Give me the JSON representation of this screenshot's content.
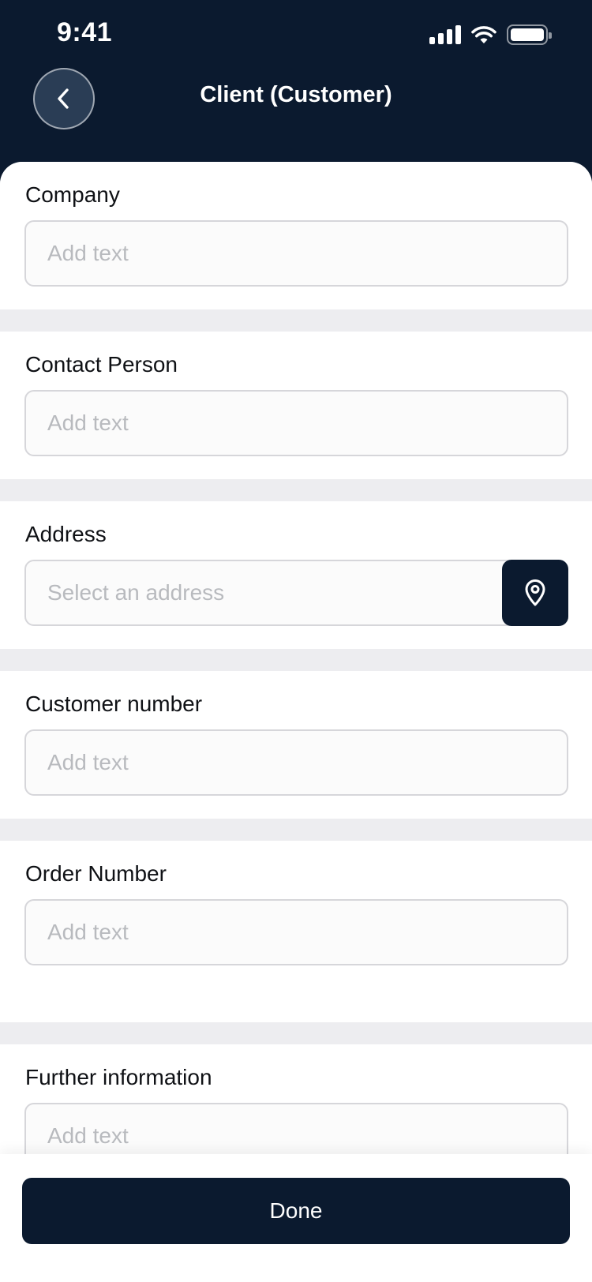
{
  "status_bar": {
    "time": "9:41"
  },
  "header": {
    "title": "Client (Customer)"
  },
  "fields": {
    "company": {
      "label": "Company",
      "placeholder": "Add text",
      "value": ""
    },
    "contact_person": {
      "label": "Contact Person",
      "placeholder": "Add text",
      "value": ""
    },
    "address": {
      "label": "Address",
      "placeholder": "Select an address",
      "value": ""
    },
    "customer_number": {
      "label": "Customer number",
      "placeholder": "Add text",
      "value": ""
    },
    "order_number": {
      "label": "Order Number",
      "placeholder": "Add text",
      "value": ""
    },
    "further_information": {
      "label": "Further information",
      "placeholder": "Add text",
      "value": ""
    }
  },
  "footer": {
    "done_label": "Done"
  },
  "icons": {
    "back": "chevron-left-icon",
    "location": "map-pin-icon",
    "signal": "cellular-signal-icon",
    "wifi": "wifi-icon",
    "battery": "battery-icon"
  },
  "colors": {
    "primary": "#0b1a2f",
    "background": "#ededf0",
    "input_border": "#d6d6da",
    "placeholder": "#b8babe"
  }
}
